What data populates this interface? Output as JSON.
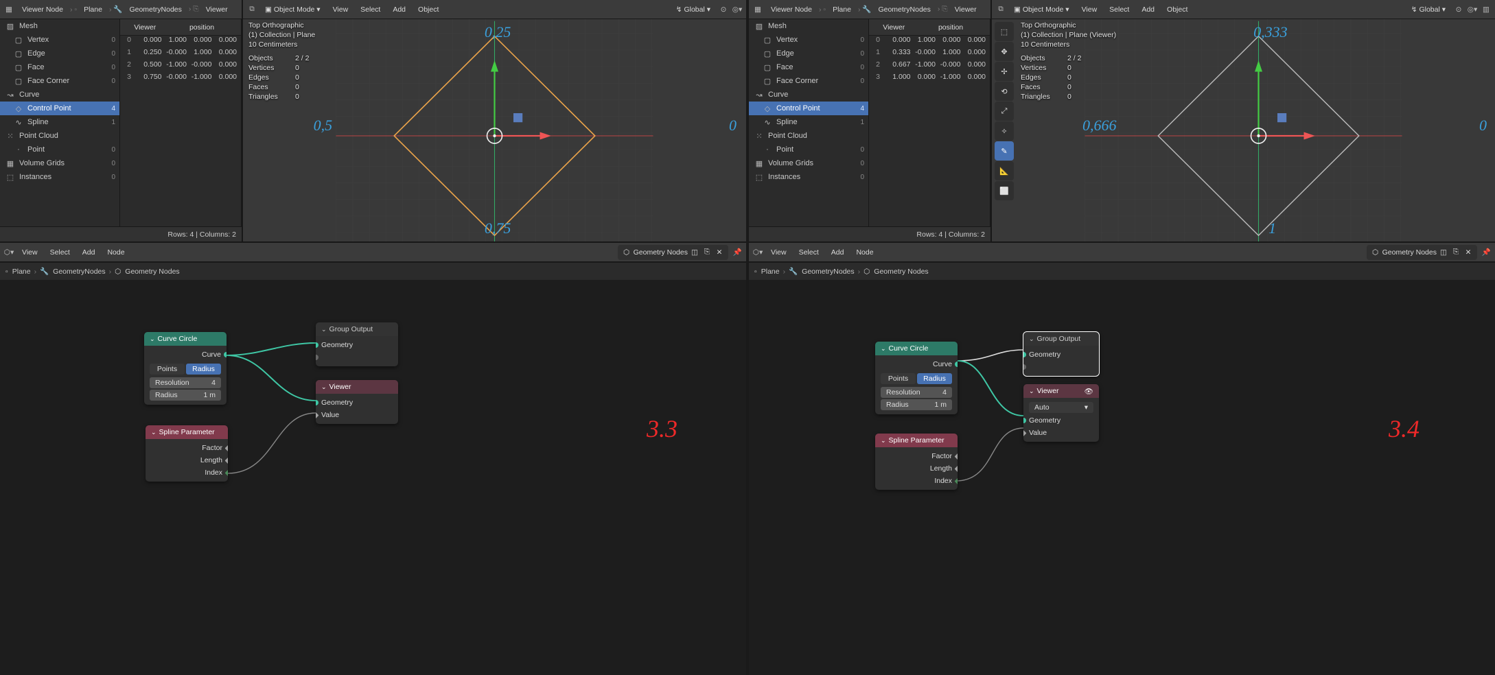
{
  "left": {
    "header": {
      "editor": "Viewer Node",
      "obj": "Plane",
      "mod": "GeometryNodes",
      "node": "Viewer"
    },
    "tree": {
      "mesh": "Mesh",
      "vertex": "Vertex",
      "vertex_n": "0",
      "edge": "Edge",
      "edge_n": "0",
      "face": "Face",
      "face_n": "0",
      "facecorner": "Face Corner",
      "fc_n": "0",
      "curve": "Curve",
      "controlpoint": "Control Point",
      "cp_n": "4",
      "spline": "Spline",
      "spline_n": "1",
      "pointcloud": "Point Cloud",
      "point": "Point",
      "point_n": "0",
      "volume": "Volume Grids",
      "vol_n": "0",
      "instances": "Instances",
      "inst_n": "0"
    },
    "sheet": {
      "col_viewer": "Viewer",
      "col_pos": "position",
      "rows": [
        {
          "i": "0",
          "v": "0.000",
          "x": "1.000",
          "y": "0.000",
          "z": "0.000"
        },
        {
          "i": "1",
          "v": "0.250",
          "x": "-0.000",
          "y": "1.000",
          "z": "0.000"
        },
        {
          "i": "2",
          "v": "0.500",
          "x": "-1.000",
          "y": "-0.000",
          "z": "0.000"
        },
        {
          "i": "3",
          "v": "0.750",
          "x": "-0.000",
          "y": "-1.000",
          "z": "0.000"
        }
      ],
      "footer": "Rows: 4   |   Columns: 2"
    },
    "vphdr": {
      "mode": "Object Mode",
      "view": "View",
      "select": "Select",
      "add": "Add",
      "object": "Object",
      "orient": "Global"
    },
    "stats": {
      "view": "Top Orthographic",
      "coll": "(1) Collection | Plane",
      "grid": "10 Centimeters",
      "objects_l": "Objects",
      "objects_v": "2 / 2",
      "verts_l": "Vertices",
      "verts_v": "0",
      "edges_l": "Edges",
      "edges_v": "0",
      "faces_l": "Faces",
      "faces_v": "0",
      "tris_l": "Triangles",
      "tris_v": "0"
    },
    "annot": {
      "top": "0,25",
      "right": "0",
      "bottom": "0,75",
      "left": "0,5"
    },
    "nodehd": {
      "view": "View",
      "select": "Select",
      "add": "Add",
      "node": "Node",
      "chip": "Geometry Nodes"
    },
    "crumb": {
      "obj": "Plane",
      "mod": "GeometryNodes",
      "tree": "Geometry Nodes"
    },
    "nodes": {
      "curvecircle": "Curve Circle",
      "curve_out": "Curve",
      "points": "Points",
      "radius_mode": "Radius",
      "res_l": "Resolution",
      "res_v": "4",
      "rad_l": "Radius",
      "rad_v": "1 m",
      "groupout": "Group Output",
      "geom": "Geometry",
      "viewer": "Viewer",
      "value": "Value",
      "spline": "Spline Parameter",
      "factor": "Factor",
      "length": "Length",
      "index": "Index"
    },
    "version": "3.3"
  },
  "right": {
    "header": {
      "editor": "Viewer Node",
      "obj": "Plane",
      "mod": "GeometryNodes",
      "node": "Viewer"
    },
    "tree": {
      "mesh": "Mesh",
      "vertex": "Vertex",
      "vertex_n": "0",
      "edge": "Edge",
      "edge_n": "0",
      "face": "Face",
      "face_n": "0",
      "facecorner": "Face Corner",
      "fc_n": "0",
      "curve": "Curve",
      "controlpoint": "Control Point",
      "cp_n": "4",
      "spline": "Spline",
      "spline_n": "1",
      "pointcloud": "Point Cloud",
      "point": "Point",
      "point_n": "0",
      "volume": "Volume Grids",
      "vol_n": "0",
      "instances": "Instances",
      "inst_n": "0"
    },
    "sheet": {
      "col_viewer": "Viewer",
      "col_pos": "position",
      "rows": [
        {
          "i": "0",
          "v": "0.000",
          "x": "1.000",
          "y": "0.000",
          "z": "0.000"
        },
        {
          "i": "1",
          "v": "0.333",
          "x": "-0.000",
          "y": "1.000",
          "z": "0.000"
        },
        {
          "i": "2",
          "v": "0.667",
          "x": "-1.000",
          "y": "-0.000",
          "z": "0.000"
        },
        {
          "i": "3",
          "v": "1.000",
          "x": "0.000",
          "y": "-1.000",
          "z": "0.000"
        }
      ],
      "footer": "Rows: 4   |   Columns: 2"
    },
    "vphdr": {
      "mode": "Object Mode",
      "view": "View",
      "select": "Select",
      "add": "Add",
      "object": "Object",
      "orient": "Global"
    },
    "stats": {
      "view": "Top Orthographic",
      "coll": "(1) Collection | Plane (Viewer)",
      "grid": "10 Centimeters",
      "objects_l": "Objects",
      "objects_v": "2 / 2",
      "verts_l": "Vertices",
      "verts_v": "0",
      "edges_l": "Edges",
      "edges_v": "0",
      "faces_l": "Faces",
      "faces_v": "0",
      "tris_l": "Triangles",
      "tris_v": "0"
    },
    "annot": {
      "top": "0,333",
      "right": "0",
      "bottom": "1",
      "left": "0,666"
    },
    "nodehd": {
      "view": "View",
      "select": "Select",
      "add": "Add",
      "node": "Node",
      "chip": "Geometry Nodes"
    },
    "crumb": {
      "obj": "Plane",
      "mod": "GeometryNodes",
      "tree": "Geometry Nodes"
    },
    "nodes": {
      "curvecircle": "Curve Circle",
      "curve_out": "Curve",
      "points": "Points",
      "radius_mode": "Radius",
      "res_l": "Resolution",
      "res_v": "4",
      "rad_l": "Radius",
      "rad_v": "1 m",
      "groupout": "Group Output",
      "geom": "Geometry",
      "viewer": "Viewer",
      "auto": "Auto",
      "value": "Value",
      "spline": "Spline Parameter",
      "factor": "Factor",
      "length": "Length",
      "index": "Index"
    },
    "version": "3.4"
  }
}
